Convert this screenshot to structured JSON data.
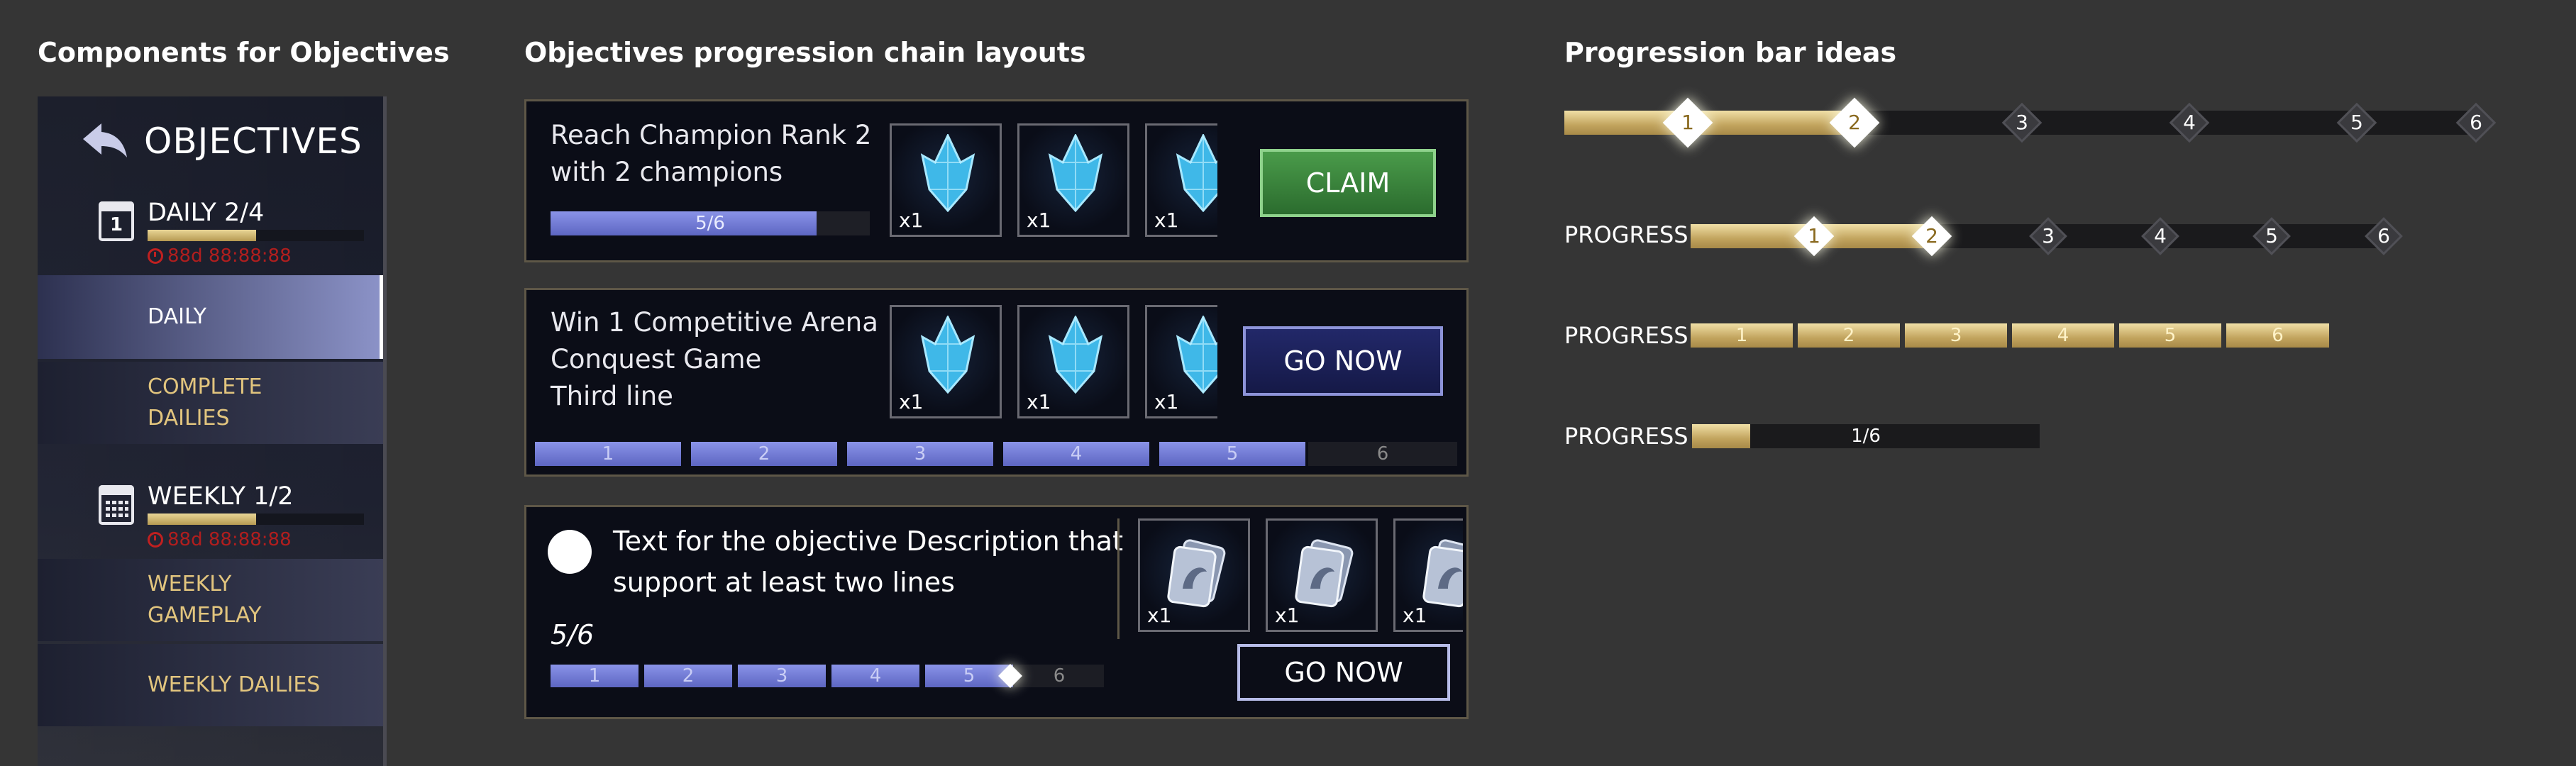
{
  "sections": {
    "components_title": "Components for Objectives",
    "chain_title": "Objectives progression chain layouts",
    "ideas_title": "Progression bar ideas"
  },
  "objectives_panel": {
    "header": "OBJECTIVES",
    "daily": {
      "icon_number": "1",
      "label": "DAILY 2/4",
      "timer": "88d 88:88:88",
      "progress": 0.5
    },
    "daily_items": [
      {
        "label": "DAILY",
        "active": true
      },
      {
        "label_line1": "COMPLETE",
        "label_line2": "DAILIES"
      }
    ],
    "weekly": {
      "label": "WEEKLY 1/2",
      "timer": "88d 88:88:88",
      "progress": 0.5
    },
    "weekly_items": [
      {
        "label_line1": "WEEKLY",
        "label_line2": "GAMEPLAY"
      },
      {
        "label": "WEEKLY DAILIES"
      }
    ]
  },
  "chain_cards": [
    {
      "line1": "Reach Champion Rank 2",
      "line2": "with 2 champions",
      "progress_text": "5/6",
      "progress": 0.833,
      "rewards": [
        {
          "qty": "x1"
        },
        {
          "qty": "x1"
        },
        {
          "qty": "x1"
        }
      ],
      "button": "CLAIM"
    },
    {
      "line1": "Win 1 Competitive Arena",
      "line2": "Conquest Game",
      "line3": "Third line",
      "rewards": [
        {
          "qty": "x1"
        },
        {
          "qty": "x1"
        },
        {
          "qty": "x1"
        }
      ],
      "segments": [
        "1",
        "2",
        "3",
        "4",
        "5",
        "6"
      ],
      "filled": 5,
      "button": "GO NOW"
    },
    {
      "line1": "Text for the objective Description that",
      "line2": "support at least two lines",
      "progress_text": "5/6",
      "rewards": [
        {
          "qty": "x1"
        },
        {
          "qty": "x1"
        },
        {
          "qty": "x1"
        }
      ],
      "segments": [
        "1",
        "2",
        "3",
        "4",
        "5",
        "6"
      ],
      "filled": 5,
      "button": "GO NOW"
    }
  ],
  "progress_ideas": {
    "bar1": {
      "nodes": [
        "1",
        "2",
        "3",
        "4",
        "5",
        "6"
      ],
      "reached": 2
    },
    "bar2": {
      "label": "PROGRESS",
      "nodes": [
        "1",
        "2",
        "3",
        "4",
        "5",
        "6"
      ],
      "reached": 2
    },
    "bar3": {
      "label": "PROGRESS",
      "segments": [
        "1",
        "2",
        "3",
        "4",
        "5",
        "6"
      ]
    },
    "bar4": {
      "label": "PROGRESS",
      "text": "1/6",
      "progress": 0.167
    }
  },
  "colors": {
    "background": "#353535",
    "gold": "#c2a45e",
    "blue_progress": "#6f78d6",
    "claim_green": "#3f8a40",
    "timer_red": "#b01e1e"
  },
  "icons": [
    "back-arrow-icon",
    "calendar-day-icon",
    "calendar-week-icon",
    "clock-icon",
    "crystal-icon",
    "card-pack-icon",
    "checkbox-circle-icon"
  ]
}
